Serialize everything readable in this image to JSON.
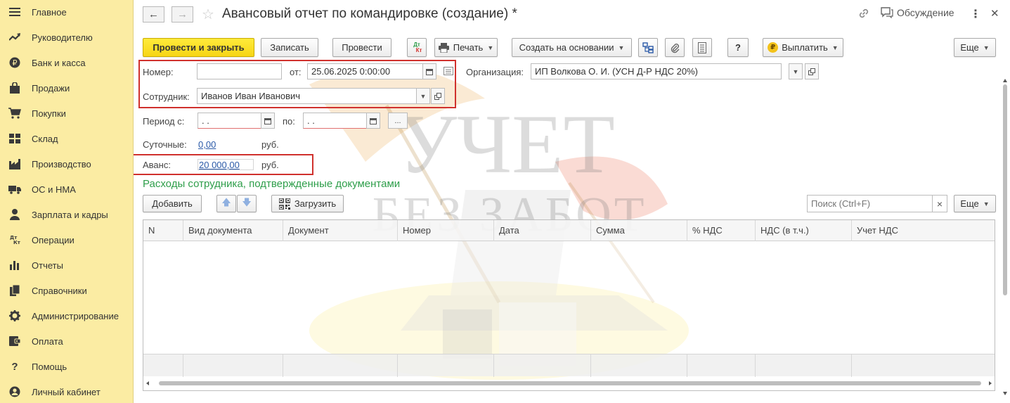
{
  "sidebar": {
    "items": [
      {
        "label": "Главное",
        "icon": "menu-icon"
      },
      {
        "label": "Руководителю",
        "icon": "trend-icon"
      },
      {
        "label": "Банк и касса",
        "icon": "ruble-coin-icon"
      },
      {
        "label": "Продажи",
        "icon": "shopping-bag-icon"
      },
      {
        "label": "Покупки",
        "icon": "cart-icon"
      },
      {
        "label": "Склад",
        "icon": "warehouse-grid-icon"
      },
      {
        "label": "Производство",
        "icon": "factory-icon"
      },
      {
        "label": "ОС и НМА",
        "icon": "truck-icon"
      },
      {
        "label": "Зарплата и кадры",
        "icon": "person-icon"
      },
      {
        "label": "Операции",
        "icon": "debit-credit-icon"
      },
      {
        "label": "Отчеты",
        "icon": "bar-chart-icon"
      },
      {
        "label": "Справочники",
        "icon": "books-icon"
      },
      {
        "label": "Администрирование",
        "icon": "gear-icon"
      },
      {
        "label": "Оплата",
        "icon": "wallet-icon"
      },
      {
        "label": "Помощь",
        "icon": "question-icon"
      },
      {
        "label": "Личный кабинет",
        "icon": "user-circle-icon"
      }
    ]
  },
  "header": {
    "back_icon": "←",
    "forward_icon": "→",
    "star_icon": "☆",
    "title": "Авансовый отчет по командировке (создание) *",
    "discussion_label": "Обсуждение",
    "more_icon": "⋮",
    "close_icon": "✕"
  },
  "toolbar": {
    "post_close_label": "Провести и закрыть",
    "save_label": "Записать",
    "post_label": "Провести",
    "dtkt_label_top": "Дт",
    "dtkt_label_bottom": "Кт",
    "print_label": "Печать",
    "create_basis_label": "Создать на основании",
    "help_label": "?",
    "pay_label": "Выплатить",
    "pay_icon_char": "₽",
    "more_label": "Еще"
  },
  "form": {
    "number_label": "Номер:",
    "number_value": "",
    "date_label": "от:",
    "date_value": "25.06.2025  0:00:00",
    "org_label": "Организация:",
    "org_value": "ИП Волкова О. И. (УСН Д-Р НДС 20%)",
    "employee_label": "Сотрудник:",
    "employee_value": "Иванов Иван Иванович",
    "period_from_label": "Период с:",
    "period_from_value": " .  .",
    "period_to_label": "по:",
    "period_to_value": " .  .",
    "period_select_label": "...",
    "daily_label": "Суточные:",
    "daily_value": "0,00",
    "daily_currency": "руб.",
    "advance_label": "Аванс:",
    "advance_value": "20 000,00",
    "advance_currency": "руб."
  },
  "expenses": {
    "section_title": "Расходы сотрудника, подтвержденные документами",
    "add_label": "Добавить",
    "up_icon": "🡅",
    "down_icon": "🡇",
    "load_label": "Загрузить",
    "search_placeholder": "Поиск (Ctrl+F)",
    "search_clear": "×",
    "more_label": "Еще",
    "columns": [
      "N",
      "Вид документа",
      "Документ",
      "Номер",
      "Дата",
      "Сумма",
      "% НДС",
      "НДС (в т.ч.)",
      "Учет НДС"
    ],
    "rows": []
  },
  "watermark": {
    "line1": "УЧЕТ",
    "line2": "БЕЗ ЗАБОТ"
  },
  "colors": {
    "sidebar_bg": "#fbeca3",
    "primary_button": "#f7d516",
    "section_title": "#2e9e4a",
    "link": "#2b5aa8",
    "highlight_box": "#d0312d"
  }
}
